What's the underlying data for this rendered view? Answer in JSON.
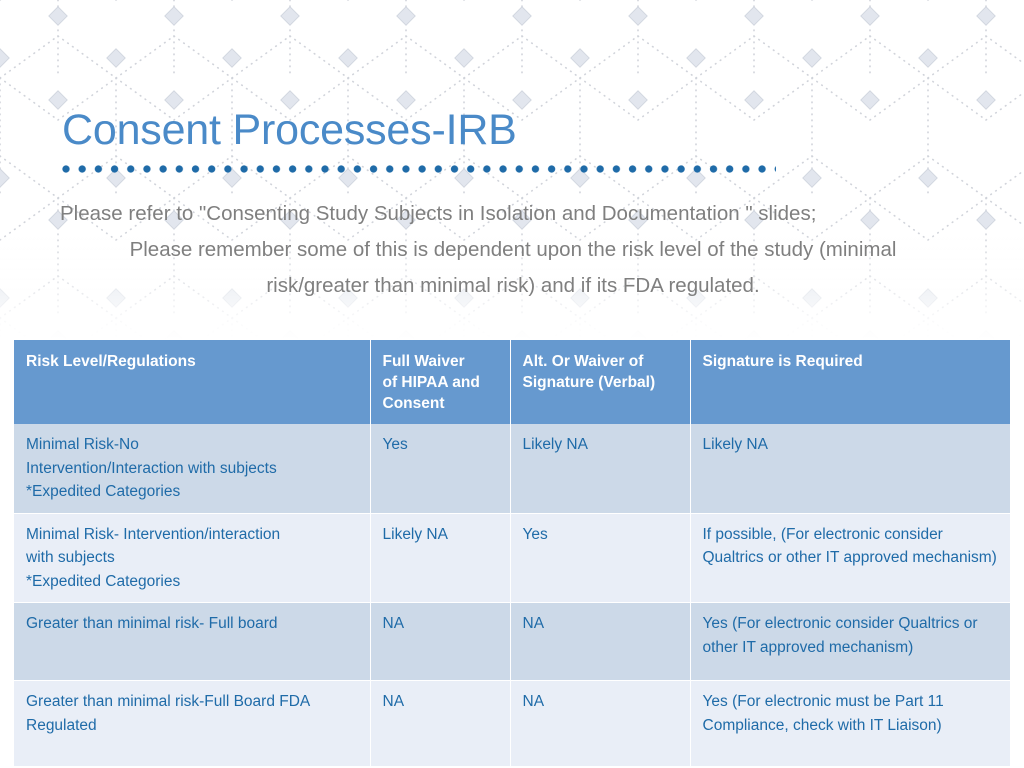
{
  "slide": {
    "title": "Consent Processes-IRB",
    "body_lines": [
      "Please refer to \"Consenting Study Subjects in Isolation and Documentation \" slides;",
      "Please remember some of this is dependent upon the risk level of the study (minimal",
      "risk/greater than minimal risk) and if its FDA regulated."
    ]
  },
  "colors": {
    "title": "#4a8ac8",
    "underline_dots": "#1f6ba8",
    "body_text": "#7f7f7f",
    "table_header_bg": "#6699cf",
    "table_header_text": "#ffffff",
    "row_odd_bg": "#ccd9e8",
    "row_even_bg": "#e9eef7",
    "cell_text": "#1f6ba8",
    "pattern_line": "#c9ccd4",
    "pattern_node": "#dfe4ec"
  },
  "table": {
    "headers": [
      "Risk Level/Regulations",
      "Full Waiver\nof HIPAA and\nConsent",
      "Alt. Or Waiver of\nSignature  (Verbal)",
      "Signature is Required"
    ],
    "rows": [
      {
        "risk_level": "Minimal Risk-No\nIntervention/Interaction with subjects\n *Expedited Categories",
        "full_waiver": "Yes",
        "alt_waiver": "Likely NA",
        "signature": "Likely NA"
      },
      {
        "risk_level": "Minimal Risk- Intervention/interaction\nwith subjects\n*Expedited Categories",
        "full_waiver": "Likely NA",
        "alt_waiver": "Yes",
        "signature": "If possible, (For electronic consider Qualtrics or other IT approved mechanism)"
      },
      {
        "risk_level": "Greater than minimal risk- Full board",
        "full_waiver": "NA",
        "alt_waiver": "NA",
        "signature": "Yes (For electronic consider Qualtrics or other IT approved mechanism)"
      },
      {
        "risk_level": "Greater than minimal risk-Full Board FDA Regulated",
        "full_waiver": "NA",
        "alt_waiver": "NA",
        "signature": "Yes (For electronic must be Part 11 Compliance, check with IT Liaison)"
      }
    ]
  }
}
